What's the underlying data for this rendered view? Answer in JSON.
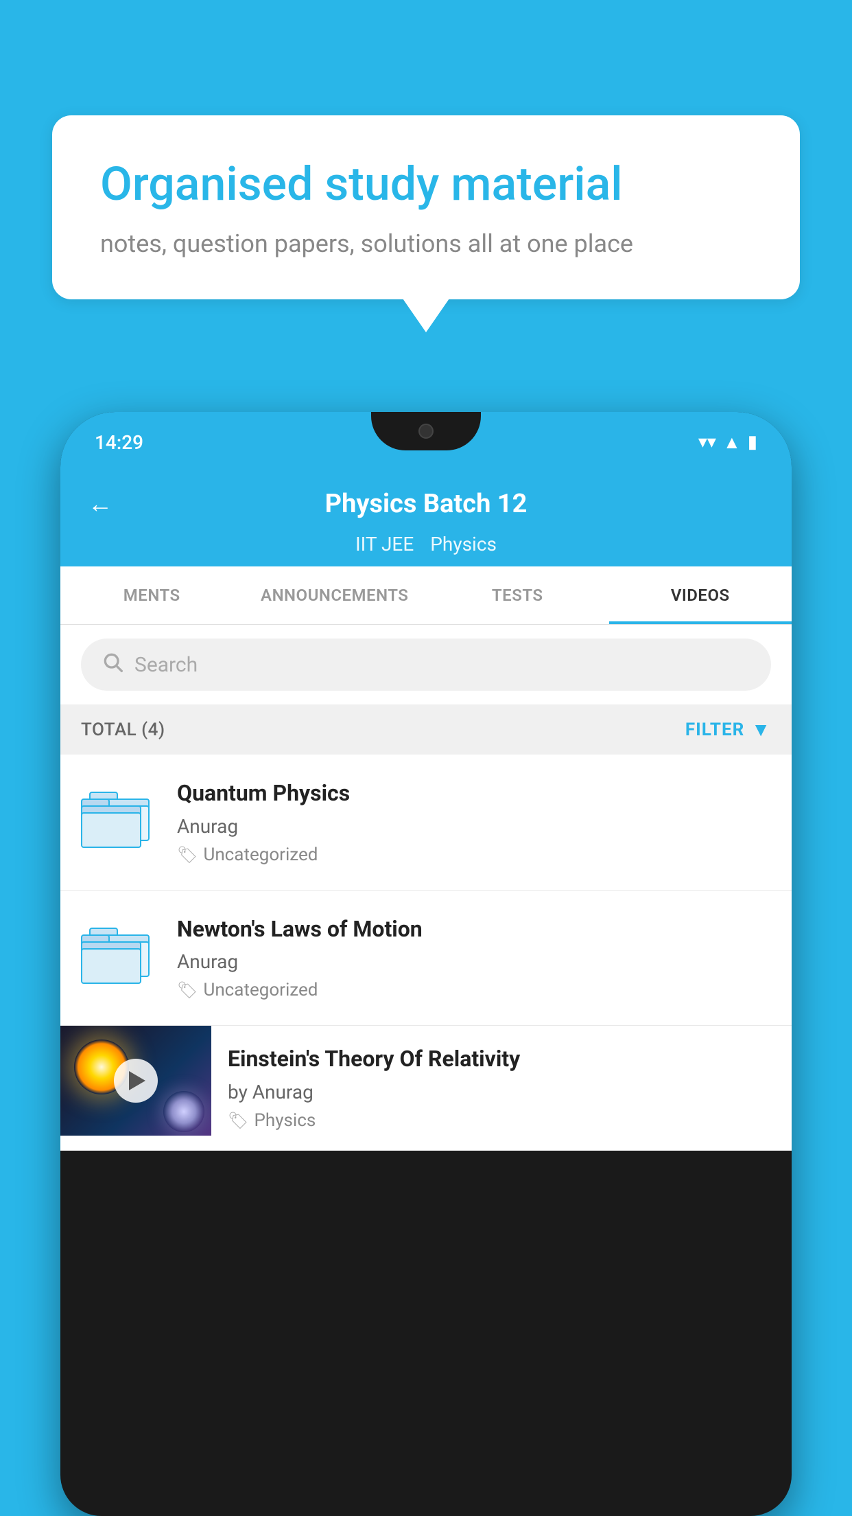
{
  "background": {
    "color": "#29b6e8"
  },
  "speech_bubble": {
    "title": "Organised study material",
    "subtitle": "notes, question papers, solutions all at one place"
  },
  "phone": {
    "status_bar": {
      "time": "14:29"
    },
    "header": {
      "back_label": "←",
      "title": "Physics Batch 12",
      "subtitle_tag1": "IIT JEE",
      "subtitle_tag2": "Physics"
    },
    "tabs": [
      {
        "label": "MENTS",
        "active": false
      },
      {
        "label": "ANNOUNCEMENTS",
        "active": false
      },
      {
        "label": "TESTS",
        "active": false
      },
      {
        "label": "VIDEOS",
        "active": true
      }
    ],
    "search": {
      "placeholder": "Search"
    },
    "filter_bar": {
      "total_label": "TOTAL (4)",
      "filter_label": "FILTER"
    },
    "videos": [
      {
        "id": "quantum",
        "title": "Quantum Physics",
        "author": "Anurag",
        "tag": "Uncategorized",
        "has_thumbnail": false
      },
      {
        "id": "newton",
        "title": "Newton's Laws of Motion",
        "author": "Anurag",
        "tag": "Uncategorized",
        "has_thumbnail": false
      },
      {
        "id": "einstein",
        "title": "Einstein's Theory Of Relativity",
        "author": "by Anurag",
        "tag": "Physics",
        "has_thumbnail": true
      }
    ]
  }
}
